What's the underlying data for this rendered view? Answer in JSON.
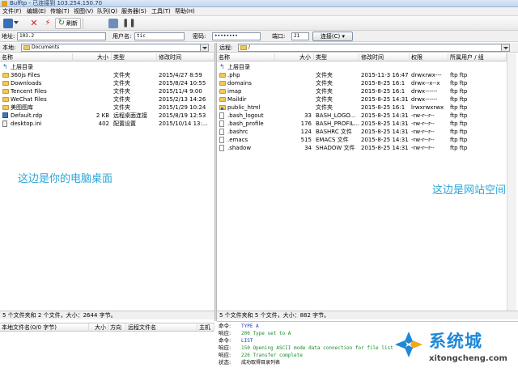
{
  "window": {
    "title": "Bufftp - 已连接到 103.254.150.70"
  },
  "menu": [
    "文件(F)",
    "编辑(E)",
    "传输(T)",
    "视图(V)",
    "队列(Q)",
    "服务器(S)",
    "工具(T)",
    "帮助(H)"
  ],
  "toolbar": {
    "refresh_label": "刷新",
    "icons": [
      "connect-icon",
      "close-icon",
      "disconnect-icon",
      "refresh-icon",
      "stop-icon",
      "transfer-icon",
      "pause-icon"
    ]
  },
  "connection": {
    "address_label": "地址:",
    "address_value": "103.2",
    "user_label": "用户名:",
    "user_value": "tic",
    "password_label": "密码:",
    "password_value": "••••••••",
    "port_label": "端口:",
    "port_value": "21",
    "connect_button": "连接(C)"
  },
  "local": {
    "label": "本地:",
    "path": "Documents",
    "columns": [
      "名称",
      "大小",
      "类型",
      "修改时间"
    ],
    "files": [
      {
        "name": "上层目录",
        "size": "",
        "type": "",
        "modified": "",
        "icon": "up"
      },
      {
        "name": "360js Files",
        "size": "",
        "type": "文件夹",
        "modified": "2015/4/27 8:59",
        "icon": "folder"
      },
      {
        "name": "Downloads",
        "size": "",
        "type": "文件夹",
        "modified": "2015/8/24 10:55",
        "icon": "folder"
      },
      {
        "name": "Tencent Files",
        "size": "",
        "type": "文件夹",
        "modified": "2015/11/4 9:00",
        "icon": "folder"
      },
      {
        "name": "WeChat Files",
        "size": "",
        "type": "文件夹",
        "modified": "2015/2/13 14:26",
        "icon": "folder"
      },
      {
        "name": "美图图库",
        "size": "",
        "type": "文件夹",
        "modified": "2015/1/29 10:24",
        "icon": "folder"
      },
      {
        "name": "Default.rdp",
        "size": "2 KB",
        "type": "远程桌面连接",
        "modified": "2015/8/19 12:53",
        "icon": "rdp"
      },
      {
        "name": "desktop.ini",
        "size": "402",
        "type": "配置设置",
        "modified": "2015/10/14 13:...",
        "icon": "ini"
      }
    ],
    "overlay": "这边是你的电脑桌面",
    "status": "5 个文件夹和 2 个文件，大小：2644 字节。"
  },
  "remote": {
    "label": "远程:",
    "path": "/",
    "columns": [
      "名称",
      "大小",
      "类型",
      "修改时间",
      "权限",
      "所属用户 / 组"
    ],
    "files": [
      {
        "name": "上层目录",
        "size": "",
        "type": "",
        "modified": "",
        "perm": "",
        "owner": "",
        "icon": "up"
      },
      {
        "name": ".php",
        "size": "",
        "type": "文件夹",
        "modified": "2015-11-3 16:47",
        "perm": "drwxrwx---",
        "owner": "ftp ftp",
        "icon": "folder"
      },
      {
        "name": "domains",
        "size": "",
        "type": "文件夹",
        "modified": "2015-8-25 16:1",
        "perm": "drwx--x--x",
        "owner": "ftp ftp",
        "icon": "folder"
      },
      {
        "name": "imap",
        "size": "",
        "type": "文件夹",
        "modified": "2015-8-25 16:1",
        "perm": "drwx------",
        "owner": "ftp ftp",
        "icon": "folder"
      },
      {
        "name": "Maildir",
        "size": "",
        "type": "文件夹",
        "modified": "2015-8-25 14:31",
        "perm": "drwx------",
        "owner": "ftp ftp",
        "icon": "folder"
      },
      {
        "name": "public_html",
        "size": "",
        "type": "文件夹",
        "modified": "2015-8-25 16:1",
        "perm": "lrwxrwxrwx",
        "owner": "ftp ftp",
        "icon": "link"
      },
      {
        "name": ".bash_logout",
        "size": "33",
        "type": "BASH_LOGO...",
        "modified": "2015-8-25 14:31",
        "perm": "-rw-r--r--",
        "owner": "ftp ftp",
        "icon": "file"
      },
      {
        "name": ".bash_profile",
        "size": "176",
        "type": "BASH_PROFIL...",
        "modified": "2015-8-25 14:31",
        "perm": "-rw-r--r--",
        "owner": "ftp ftp",
        "icon": "file"
      },
      {
        "name": ".bashrc",
        "size": "124",
        "type": "BASHRC 文件",
        "modified": "2015-8-25 14:31",
        "perm": "-rw-r--r--",
        "owner": "ftp ftp",
        "icon": "file"
      },
      {
        "name": ".emacs",
        "size": "515",
        "type": "EMACS 文件",
        "modified": "2015-8-25 14:31",
        "perm": "-rw-r--r--",
        "owner": "ftp ftp",
        "icon": "file"
      },
      {
        "name": ".shadow",
        "size": "34",
        "type": "SHADOW 文件",
        "modified": "2015-8-25 14:31",
        "perm": "-rw-r--r--",
        "owner": "ftp ftp",
        "icon": "file"
      }
    ],
    "overlay": "这边是网站空间",
    "status": "5 个文件夹和 5 个文件，大小：882 字节。"
  },
  "queue": {
    "columns": [
      "本地文件名(0/0 字节)",
      "大小",
      "方向",
      "远程文件名",
      "主机"
    ]
  },
  "log": [
    {
      "key": "命令:",
      "value": "TYPE A",
      "color": "#1a37c9"
    },
    {
      "key": "响应:",
      "value": "200 Type set to A",
      "color": "#1a8a2a"
    },
    {
      "key": "命令:",
      "value": "LIST",
      "color": "#1a37c9"
    },
    {
      "key": "响应:",
      "value": "150 Opening ASCII mode data connection for file list",
      "color": "#1a8a2a"
    },
    {
      "key": "响应:",
      "value": "226 Transfer complete",
      "color": "#1a8a2a"
    },
    {
      "key": "状态:",
      "value": "成功取得目录列表",
      "color": "#000000"
    }
  ],
  "watermark": {
    "title": "系统城",
    "url": "xitongcheng.com"
  }
}
